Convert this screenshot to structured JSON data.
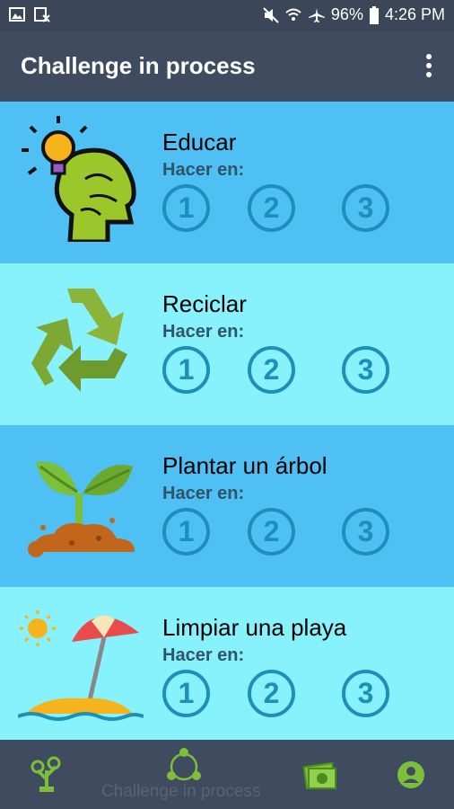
{
  "status": {
    "battery_percent": "96%",
    "time": "4:26 PM",
    "icons": [
      "image-icon",
      "photo-clear-icon",
      "mute-icon",
      "wifi-icon",
      "airplane-icon",
      "battery-icon"
    ]
  },
  "app_bar": {
    "title": "Challenge in process",
    "menu_icon": "more-vert-icon"
  },
  "challenges": [
    {
      "title": "Educar",
      "subtitle": "Hacer en:",
      "icon": "head-lightbulb-icon",
      "options": [
        "1",
        "2",
        "3"
      ]
    },
    {
      "title": "Reciclar",
      "subtitle": "Hacer en:",
      "icon": "recycle-icon",
      "options": [
        "1",
        "2",
        "3"
      ]
    },
    {
      "title": "Plantar un árbol",
      "subtitle": "Hacer en:",
      "icon": "plant-sprout-icon",
      "options": [
        "1",
        "2",
        "3"
      ]
    },
    {
      "title": "Limpiar una playa",
      "subtitle": "Hacer en:",
      "icon": "beach-umbrella-icon",
      "options": [
        "1",
        "2",
        "3"
      ]
    }
  ],
  "bottom_nav": {
    "active_label": "Challenge in process",
    "items": [
      "tree-icon",
      "share-cycle-icon",
      "money-icon",
      "account-icon"
    ]
  },
  "colors": {
    "dark_card": "#4ec0f3",
    "light_card": "#88f2fc",
    "circle": "#1d8fb8",
    "bar": "#3f4b5f",
    "nav_green": "#7bbf3a"
  }
}
